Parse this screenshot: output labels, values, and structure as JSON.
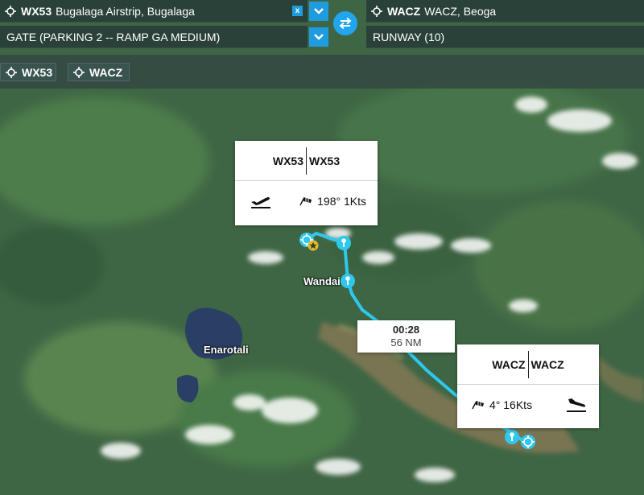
{
  "departure": {
    "code": "WX53",
    "name": "Bugalaga Airstrip, Bugalaga",
    "clear_label": "x",
    "gate": "GATE (PARKING 2 -- RAMP GA MEDIUM)"
  },
  "arrival": {
    "code": "WACZ",
    "name": "WACZ, Beoga",
    "runway": "RUNWAY (10)"
  },
  "waypoints": [
    {
      "label": "WX53"
    },
    {
      "label": "WACZ"
    }
  ],
  "map_labels": {
    "wandai": "Wandai",
    "enarotali": "Enarotali"
  },
  "popup_departure": {
    "ident_left": "WX53",
    "ident_right": "WX53",
    "wind": "198° 1Kts",
    "icon": "takeoff-icon"
  },
  "popup_arrival": {
    "ident_left": "WACZ",
    "ident_right": "WACZ",
    "wind": "4° 16Kts",
    "icon": "landing-icon"
  },
  "leg": {
    "time": "00:28",
    "distance": "56 NM"
  },
  "colors": {
    "route": "#2ec8ef",
    "accent": "#1f9be0",
    "bar_bg": "#283e3a"
  }
}
